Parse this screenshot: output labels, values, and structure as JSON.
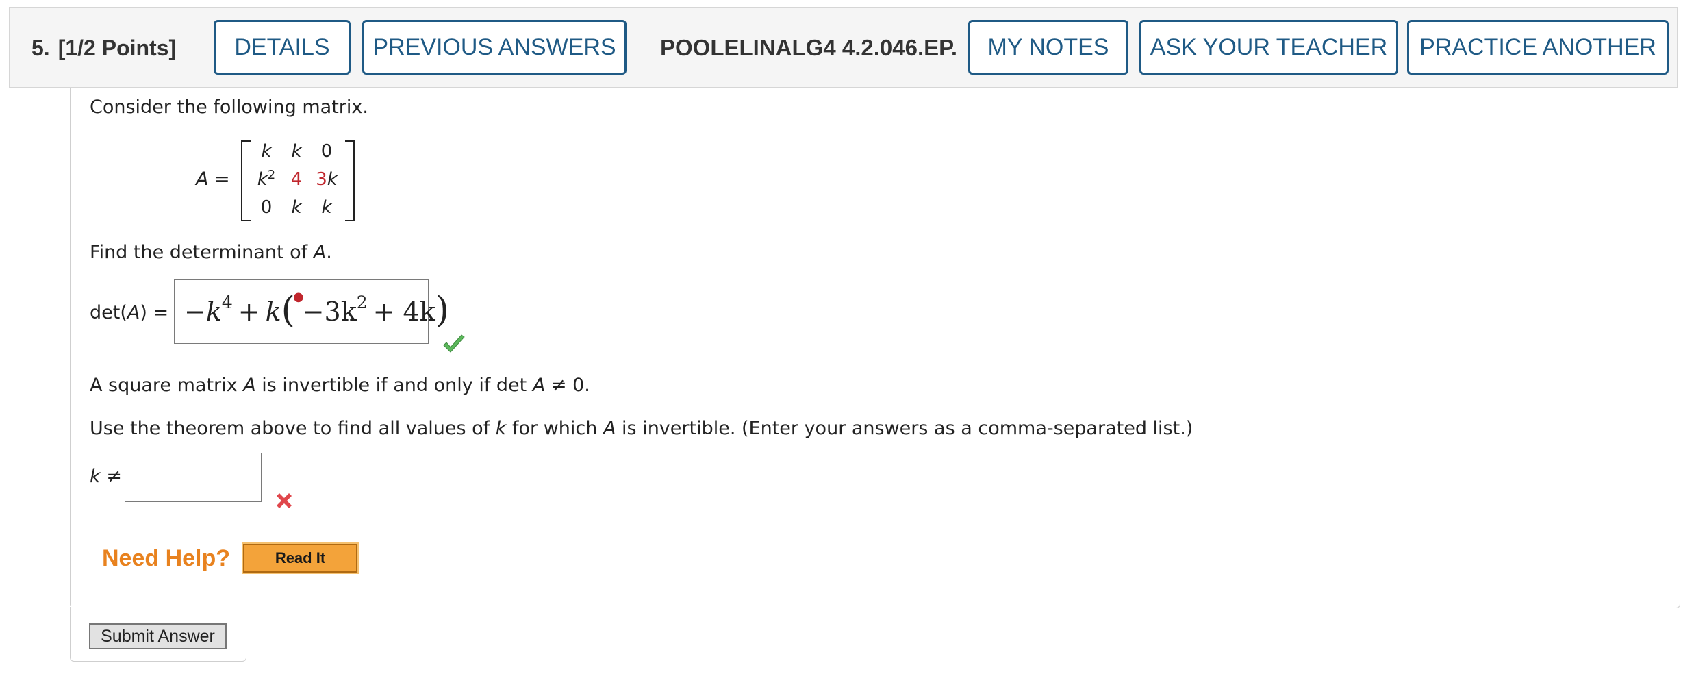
{
  "question": {
    "number": "5.",
    "points": "[1/2 Points]",
    "code": "POOLELINALG4 4.2.046.EP."
  },
  "buttons": {
    "details": "DETAILS",
    "previous_answers": "PREVIOUS ANSWERS",
    "my_notes": "MY NOTES",
    "ask_teacher": "ASK YOUR TEACHER",
    "practice_another": "PRACTICE ANOTHER"
  },
  "colors": {
    "button_border": "#1f5a85",
    "highlight_red": "#c0262d",
    "correct_green": "#5cb85c",
    "incorrect_red": "#e0474c",
    "help_orange": "#e8821f"
  },
  "content": {
    "intro": "Consider the following matrix.",
    "matrix_label": "A =",
    "matrix": {
      "r1": [
        "k",
        "k",
        "0"
      ],
      "r2": [
        "k",
        "2",
        "4",
        "3",
        "k"
      ],
      "r3": [
        "0",
        "k",
        "k"
      ]
    },
    "find_det": "Find the determinant of ",
    "find_det_var": "A",
    "find_det_end": ".",
    "det_label_pre": "det(",
    "det_label_var": "A",
    "det_label_post": ") =",
    "det_answer": {
      "minus": "−",
      "k": "k",
      "exp4": "4",
      "plus1": "+",
      "k2": "k",
      "open": "(",
      "inner": "−3k",
      "exp2": "2",
      "plus2": "+ 4k",
      "close": ")"
    },
    "det_status": "correct",
    "theorem_pre": "A square matrix ",
    "theorem_var": "A",
    "theorem_mid": " is invertible if and only if det ",
    "theorem_var2": "A",
    "theorem_end": " ≠ 0.",
    "use_pre": "Use the theorem above to find all values of ",
    "use_var": "k",
    "use_mid": " for which ",
    "use_var2": "A",
    "use_end": " is invertible. (Enter your answers as a comma-separated list.)",
    "k_label_var": "k",
    "k_label_op": " ≠",
    "k_answer_value": "",
    "k_status": "incorrect"
  },
  "help": {
    "need_help": "Need Help?",
    "read_it": "Read It"
  },
  "submit_label": "Submit Answer",
  "icons": {
    "check": "checkmark-icon",
    "cross": "cross-icon"
  }
}
